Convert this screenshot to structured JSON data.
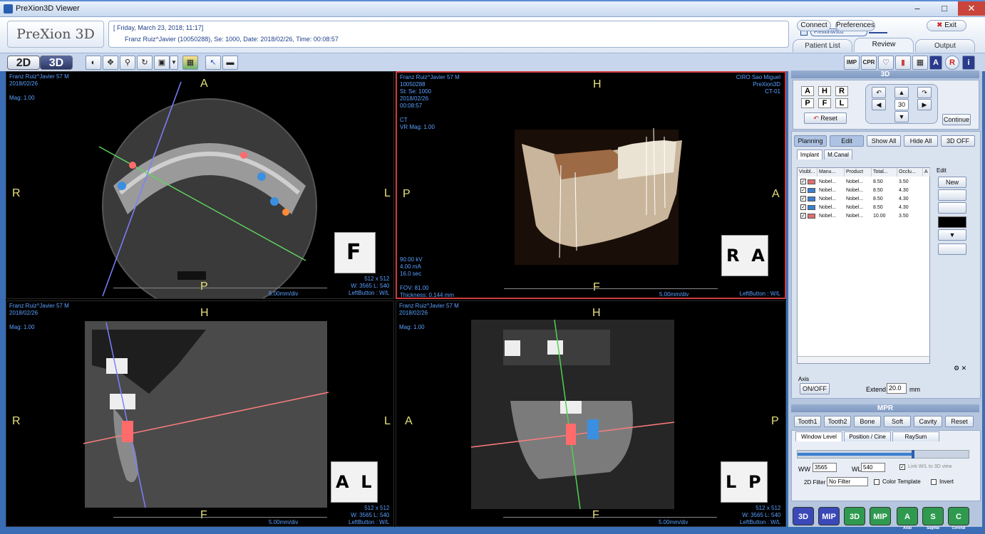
{
  "window": {
    "title": "PreXion3D Viewer"
  },
  "header": {
    "logo": "PreXion 3D",
    "date_line": "[ Friday, March 23, 2018; 11:17]",
    "patient_line": "Franz Ruiz^Javier (10050288), Se: 1000, Date: 2018/02/26, Time: 00:08:57",
    "device_pill": "PrexionW502",
    "connect": "Connect",
    "preferences": "Preferences",
    "exit": "Exit",
    "tabs": [
      "Patient List",
      "Review",
      "Output"
    ]
  },
  "toolbar": {
    "mode_2d": "2D",
    "mode_3d": "3D",
    "dropdown_arrow": "▼"
  },
  "right_toolbar": {
    "imp": "IMP",
    "cpr": "CPR",
    "a": "A",
    "r": "R",
    "i": "i"
  },
  "viewports": {
    "axial": {
      "info": "Franz Ruiz^Javier 57 M\n2018/02/26\n\nMag: 1.00",
      "top": "A",
      "bottom": "P",
      "left": "R",
      "right": "L",
      "scale": "5.00mm/div",
      "bottom_right": "512 x 512\nW: 3565 L: 540\nLeftButton : W/L",
      "cube_face": "F"
    },
    "volume": {
      "info": "Franz Ruiz^Javier 57 M\n10050288\nSt: Se: 1000\n2018/02/26\n00:08:57\n\nCT\nVR Mag: 1.00",
      "info_right": "CIRO Sao Miguel\nPreXion3D\nCT-01",
      "exposure": "90.00 kV\n4.00 mA\n16.0 sec",
      "fov": "FOV: 81.00\nThickness: 0.144 mm",
      "top": "H",
      "bottom": "F",
      "left": "P",
      "right": "A",
      "scale": "5.00mm/div",
      "bottom_right": "LeftButton : W/L",
      "cube_face": "R  A"
    },
    "sagittal": {
      "info": "Franz Ruiz^Javier 57 M\n2018/02/26\n\nMag: 1.00",
      "top": "H",
      "bottom": "F",
      "left": "R",
      "right": "L",
      "scale": "5.00mm/div",
      "bottom_right": "512 x 512\nW: 3565 L: 540\nLeftButton : W/L",
      "cube_face": "A  L"
    },
    "coronal": {
      "info": "Franz Ruiz^Javier 57 M\n2018/02/26\n\nMag: 1.00",
      "top": "H",
      "bottom": "F",
      "left": "A",
      "right": "P",
      "scale": "5.00mm/div",
      "bottom_right": "512 x 512\nW: 3565 L: 540\nLeftButton : W/L",
      "cube_face": "L  P"
    }
  },
  "panel3d": {
    "header": "3D",
    "letters": [
      "A",
      "H",
      "R",
      "P",
      "F",
      "L"
    ],
    "reset": "Reset",
    "step": "30",
    "continue": "Continue"
  },
  "planning": {
    "buttons": [
      "Planning",
      "Edit",
      "Show All",
      "Hide All",
      "3D OFF"
    ],
    "tabs": [
      "Implant",
      "M.Canal"
    ],
    "columns": [
      "Visibl...",
      "Manu...",
      "Product",
      "Total...",
      "Occlu...",
      "A"
    ],
    "rows": [
      {
        "manu": "Nobel...",
        "product": "Nobel...",
        "total": "8.50",
        "occlu": "3.50"
      },
      {
        "manu": "Nobel...",
        "product": "Nobel...",
        "total": "8.50",
        "occlu": "4.30"
      },
      {
        "manu": "Nobel...",
        "product": "Nobel...",
        "total": "8.50",
        "occlu": "4.30"
      },
      {
        "manu": "Nobel...",
        "product": "Nobel...",
        "total": "8.50",
        "occlu": "4.30"
      },
      {
        "manu": "Nobel...",
        "product": "Nobel...",
        "total": "10.00",
        "occlu": "3.50"
      }
    ],
    "row_colors": [
      "#e06f6f",
      "#3a7fd0",
      "#3a7fd0",
      "#3a7fd0",
      "#e06f6f"
    ],
    "edit_label": "Edit",
    "new": "New",
    "axis_label": "Axis",
    "onoff": "ON/OFF",
    "extend_label": "Extend",
    "extend_value": "20.0",
    "extend_unit": "mm"
  },
  "mpr": {
    "header": "MPR",
    "presets": [
      "Tooth1",
      "Tooth2",
      "Bone",
      "Soft",
      "Cavity",
      "Reset"
    ],
    "tabs": [
      "Window Level",
      "Position / Cine",
      "RaySum"
    ],
    "ww_label": "WW",
    "ww_value": "3565",
    "wl_label": "WL",
    "wl_value": "540",
    "link_label": "Link W/L to 3D view",
    "filter_label": "2D Filter",
    "filter_value": "No Filter",
    "color_template": "Color Template",
    "invert": "Invert"
  },
  "bottom_icons": [
    "3D",
    "MIP",
    "3D",
    "MIP",
    "A",
    "S",
    "C"
  ],
  "bottom_icon_subs": [
    "",
    "",
    "",
    "",
    "Axial",
    "Sagittal",
    "Coronal"
  ]
}
